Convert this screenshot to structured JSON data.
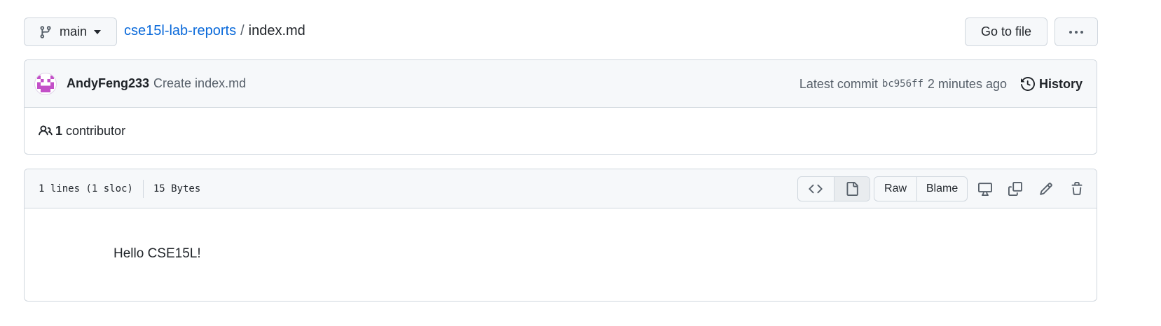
{
  "topbar": {
    "branch_label": "main",
    "repo_name": "cse15l-lab-reports",
    "separator": "/",
    "file_name": "index.md",
    "goto_label": "Go to file",
    "more_icon": "kebab-horizontal-icon"
  },
  "commit": {
    "author": "AndyFeng233",
    "message": "Create index.md",
    "latest_prefix": "Latest commit",
    "sha": "bc956ff",
    "time": "2 minutes ago",
    "history_label": "History"
  },
  "contributors": {
    "count": "1",
    "label": "contributor"
  },
  "file": {
    "lines_info": "1 lines (1 sloc)",
    "size_info": "15 Bytes",
    "raw_label": "Raw",
    "blame_label": "Blame",
    "content": "Hello CSE15L!"
  },
  "colors": {
    "link": "#0969da",
    "border": "#d0d7de",
    "header_bg": "#f6f8fa",
    "avatar": "#c34fc8"
  }
}
